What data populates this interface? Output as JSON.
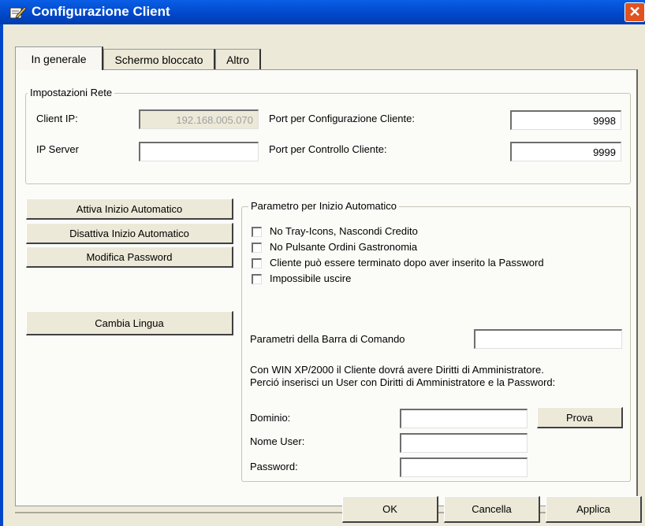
{
  "window": {
    "title": "Configurazione Client",
    "close_glyph": "✕"
  },
  "tabs": [
    {
      "label": "In generale"
    },
    {
      "label": "Schermo bloccato"
    },
    {
      "label": "Altro"
    }
  ],
  "network": {
    "group_title": "Impostazioni Rete",
    "client_ip_label": "Client IP:",
    "client_ip_value": "192.168.005.070",
    "ip_server_label": "IP Server",
    "ip_server_value": "",
    "port_config_label": "Port per Configurazione Cliente:",
    "port_config_value": "9998",
    "port_control_label": "Port per Controllo Cliente:",
    "port_control_value": "9999"
  },
  "left_buttons": {
    "enable_autostart": "Attiva Inizio Automatico",
    "disable_autostart": "Disattiva Inizio Automatico",
    "change_password": "Modifica Password",
    "change_language": "Cambia Lingua"
  },
  "autostart": {
    "group_title": "Parametro per Inizio Automatico",
    "options": [
      {
        "label": "No Tray-Icons, Nascondi Credito",
        "checked": false
      },
      {
        "label": "No Pulsante Ordini Gastronomia",
        "checked": false
      },
      {
        "label": "Cliente può essere terminato dopo aver inserito la Password",
        "checked": false
      },
      {
        "label": "Impossibile uscire",
        "checked": false
      }
    ],
    "command_bar_label": "Parametri della Barra di Comando",
    "command_bar_value": "",
    "admin_note_1": "Con WIN XP/2000 il Cliente dovrá avere Diritti di Amministratore.",
    "admin_note_2": "Perció inserisci un User con Diritti di Amministratore e la Password:",
    "domain_label": "Dominio:",
    "domain_value": "",
    "test_button": "Prova",
    "user_label": "Nome User:",
    "user_value": "",
    "password_label": "Password:",
    "password_value": ""
  },
  "footer": {
    "ok": "OK",
    "cancel": "Cancella",
    "apply": "Applica"
  },
  "colors": {
    "titlebar": "#0047c9",
    "close": "#e0521f",
    "face": "#ece9d8"
  }
}
